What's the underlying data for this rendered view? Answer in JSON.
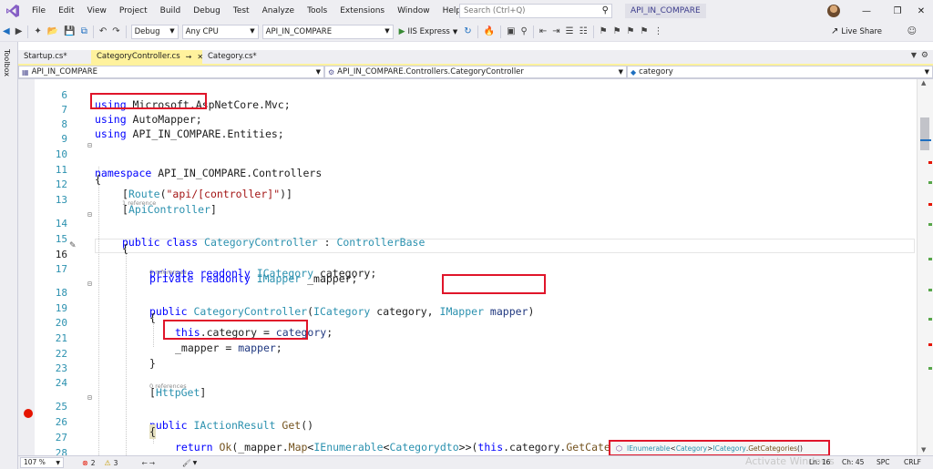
{
  "menu": {
    "items": [
      "File",
      "Edit",
      "View",
      "Project",
      "Build",
      "Debug",
      "Test",
      "Analyze",
      "Tools",
      "Extensions",
      "Window",
      "Help"
    ],
    "search_placeholder": "Search (Ctrl+Q)",
    "project_name": "API_IN_COMPARE"
  },
  "toolbar": {
    "config": "Debug",
    "platform": "Any CPU",
    "startup_project": "API_IN_COMPARE",
    "run_target": "IIS Express",
    "live_share": "Live Share"
  },
  "toolbox": {
    "label": "Toolbox"
  },
  "tabs": [
    {
      "label": "Startup.cs*",
      "active": false
    },
    {
      "label": "CategoryController.cs",
      "active": true
    },
    {
      "label": "Category.cs*",
      "active": false
    }
  ],
  "navbar": {
    "project": "API_IN_COMPARE",
    "type": "API_IN_COMPARE.Controllers.CategoryController",
    "member": "category"
  },
  "editor": {
    "lines": [
      {
        "n": "6"
      },
      {
        "n": "7"
      },
      {
        "n": "8"
      },
      {
        "n": "9"
      },
      {
        "n": "10"
      },
      {
        "n": "11"
      },
      {
        "n": "12"
      },
      {
        "n": "13"
      },
      {
        "n": "14"
      },
      {
        "n": "15"
      },
      {
        "n": "16"
      },
      {
        "n": "17"
      },
      {
        "n": "18"
      },
      {
        "n": "19"
      },
      {
        "n": "20"
      },
      {
        "n": "21"
      },
      {
        "n": "22"
      },
      {
        "n": "23"
      },
      {
        "n": "24"
      },
      {
        "n": "25"
      },
      {
        "n": "26"
      },
      {
        "n": "27"
      },
      {
        "n": "28"
      }
    ],
    "lens": {
      "one_reference": "1 reference",
      "zero_references_a": "0 references",
      "zero_references_b": "0 references"
    },
    "code": {
      "l6_a": "using",
      "l6_b": " Microsoft.AspNetCore.Mvc;",
      "l7_a": "using",
      "l7_b": " AutoMapper;",
      "l8_a": "using",
      "l8_b": " API_IN_COMPARE.Entities;",
      "l10_a": "namespace",
      "l10_b": " API_IN_COMPARE.Controllers",
      "l11": "{",
      "l12_a": "[",
      "l12_b": "Route",
      "l12_c": "(",
      "l12_d": "\"api/[controller]\"",
      "l12_e": ")]",
      "l13_a": "[",
      "l13_b": "ApiController",
      "l13_c": "]",
      "l14_a": "public",
      "l14_b": " class",
      "l14_c": " CategoryController",
      "l14_d": " : ",
      "l14_e": "ControllerBase",
      "l15": "{",
      "l16_a": "private",
      "l16_b": " readonly",
      "l16_c": " ICategory",
      "l16_d": " category;",
      "l17_a": "private",
      "l17_b": " readonly",
      "l17_c": " IMapper",
      "l17_d": " _mapper;",
      "l18_a": "public",
      "l18_b": " CategoryController",
      "l18_c": "(",
      "l18_d": "ICategory",
      "l18_e": " category, ",
      "l18_f": "IMapper",
      "l18_g": " mapper",
      "l18_h": ")",
      "l19": "{",
      "l20_a": "this",
      "l20_b": ".category = ",
      "l20_c": "category",
      "l20_d": ";",
      "l21_a": "_mapper = ",
      "l21_b": "mapper",
      "l21_c": ";",
      "l22": "}",
      "l24_a": "[",
      "l24_b": "HttpGet",
      "l24_c": "]",
      "l25_a": "public",
      "l25_b": " IActionResult",
      "l25_c": " Get",
      "l25_d": "()",
      "l26": "{",
      "l27_a": "return",
      "l27_b": " Ok",
      "l27_c": "(_mapper.",
      "l27_d": "Map",
      "l27_e": "<",
      "l27_f": "IEnumerable",
      "l27_g": "<",
      "l27_h": "Categorydto",
      "l27_i": ">>(",
      "l27_j": "this",
      "l27_k": ".category.",
      "l27_l": "GetCategories",
      "l27_m": "()));",
      "l28": "}"
    }
  },
  "tooltip": {
    "t1": "IEnumerable",
    "t2": "<",
    "t3": "Category",
    "t4": "> ",
    "t5": "ICategory",
    "t6": ".",
    "t7": "GetCategories",
    "t8": "()"
  },
  "status": {
    "zoom": "107 %",
    "errors": "2",
    "warnings": "3",
    "line": "Ln: 16",
    "col": "Ch: 45",
    "spc": "SPC",
    "crlf": "CRLF",
    "watermark": "Activate Windows"
  },
  "colors": {
    "keyword": "#0000ff",
    "type": "#2b91af",
    "string": "#a31515",
    "highlight_box": "#e0152a",
    "active_tab": "#fff29d"
  }
}
